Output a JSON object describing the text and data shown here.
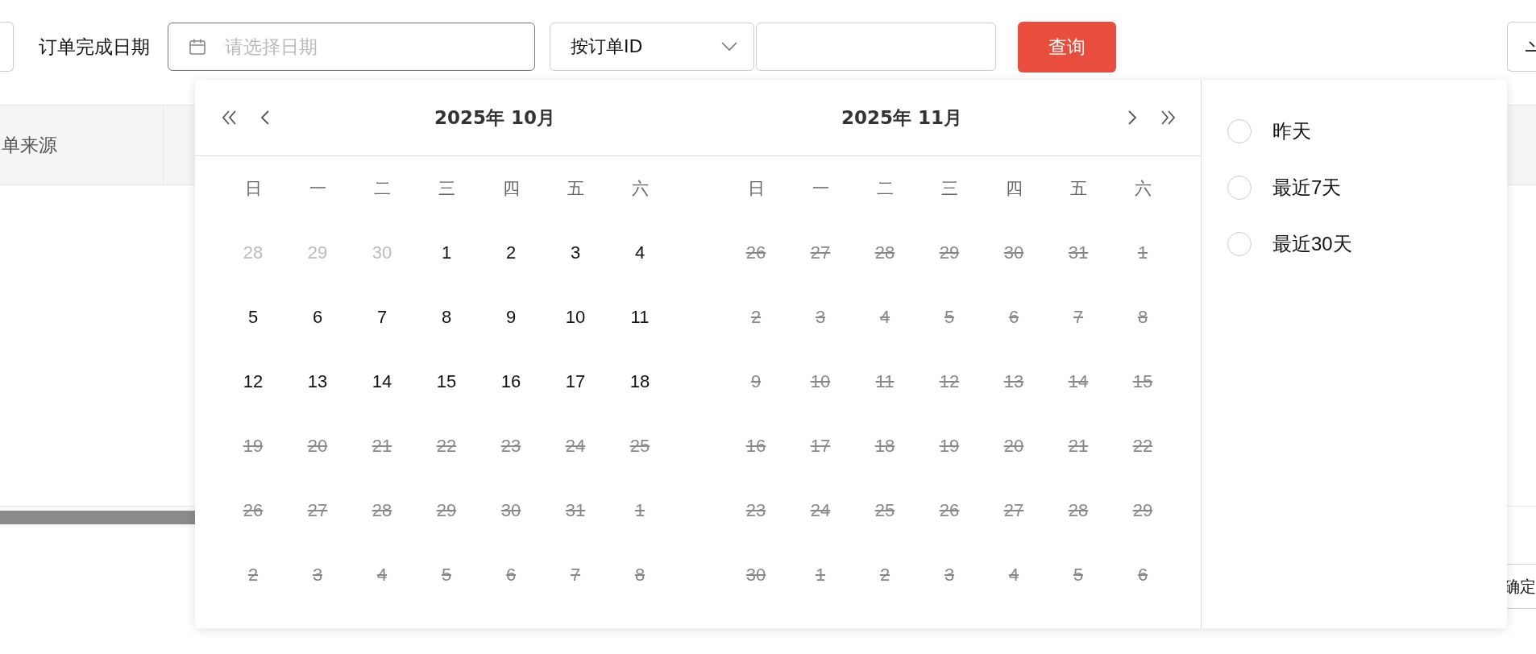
{
  "filter": {
    "label": "订单完成日期",
    "date_field": {
      "placeholder": "请选择日期"
    },
    "id_select": {
      "value": "按订单ID"
    },
    "query_button": "查询"
  },
  "table": {
    "columns": [
      "单来源"
    ]
  },
  "pager": {
    "confirm_button": "确定"
  },
  "date_picker": {
    "months": [
      {
        "title": "2025年 10月",
        "weekdays": [
          "日",
          "一",
          "二",
          "三",
          "四",
          "五",
          "六"
        ],
        "weeks": [
          [
            {
              "label": "28",
              "kind": "other"
            },
            {
              "label": "29",
              "kind": "other"
            },
            {
              "label": "30",
              "kind": "other"
            },
            {
              "label": "1",
              "kind": "current"
            },
            {
              "label": "2",
              "kind": "current"
            },
            {
              "label": "3",
              "kind": "current"
            },
            {
              "label": "4",
              "kind": "current"
            }
          ],
          [
            {
              "label": "5",
              "kind": "current"
            },
            {
              "label": "6",
              "kind": "current"
            },
            {
              "label": "7",
              "kind": "current"
            },
            {
              "label": "8",
              "kind": "current"
            },
            {
              "label": "9",
              "kind": "current"
            },
            {
              "label": "10",
              "kind": "current"
            },
            {
              "label": "11",
              "kind": "current"
            }
          ],
          [
            {
              "label": "12",
              "kind": "current"
            },
            {
              "label": "13",
              "kind": "current"
            },
            {
              "label": "14",
              "kind": "current"
            },
            {
              "label": "15",
              "kind": "current"
            },
            {
              "label": "16",
              "kind": "current"
            },
            {
              "label": "17",
              "kind": "current"
            },
            {
              "label": "18",
              "kind": "current"
            }
          ],
          [
            {
              "label": "19",
              "kind": "disabled"
            },
            {
              "label": "20",
              "kind": "disabled"
            },
            {
              "label": "21",
              "kind": "disabled"
            },
            {
              "label": "22",
              "kind": "disabled"
            },
            {
              "label": "23",
              "kind": "disabled"
            },
            {
              "label": "24",
              "kind": "disabled"
            },
            {
              "label": "25",
              "kind": "disabled"
            }
          ],
          [
            {
              "label": "26",
              "kind": "disabled"
            },
            {
              "label": "27",
              "kind": "disabled"
            },
            {
              "label": "28",
              "kind": "disabled"
            },
            {
              "label": "29",
              "kind": "disabled"
            },
            {
              "label": "30",
              "kind": "disabled"
            },
            {
              "label": "31",
              "kind": "disabled"
            },
            {
              "label": "1",
              "kind": "disabled"
            }
          ],
          [
            {
              "label": "2",
              "kind": "disabled"
            },
            {
              "label": "3",
              "kind": "disabled"
            },
            {
              "label": "4",
              "kind": "disabled"
            },
            {
              "label": "5",
              "kind": "disabled"
            },
            {
              "label": "6",
              "kind": "disabled"
            },
            {
              "label": "7",
              "kind": "disabled"
            },
            {
              "label": "8",
              "kind": "disabled"
            }
          ]
        ]
      },
      {
        "title": "2025年 11月",
        "weekdays": [
          "日",
          "一",
          "二",
          "三",
          "四",
          "五",
          "六"
        ],
        "weeks": [
          [
            {
              "label": "26",
              "kind": "disabled"
            },
            {
              "label": "27",
              "kind": "disabled"
            },
            {
              "label": "28",
              "kind": "disabled"
            },
            {
              "label": "29",
              "kind": "disabled"
            },
            {
              "label": "30",
              "kind": "disabled"
            },
            {
              "label": "31",
              "kind": "disabled"
            },
            {
              "label": "1",
              "kind": "disabled"
            }
          ],
          [
            {
              "label": "2",
              "kind": "disabled"
            },
            {
              "label": "3",
              "kind": "disabled"
            },
            {
              "label": "4",
              "kind": "disabled"
            },
            {
              "label": "5",
              "kind": "disabled"
            },
            {
              "label": "6",
              "kind": "disabled"
            },
            {
              "label": "7",
              "kind": "disabled"
            },
            {
              "label": "8",
              "kind": "disabled"
            }
          ],
          [
            {
              "label": "9",
              "kind": "disabled"
            },
            {
              "label": "10",
              "kind": "disabled"
            },
            {
              "label": "11",
              "kind": "disabled"
            },
            {
              "label": "12",
              "kind": "disabled"
            },
            {
              "label": "13",
              "kind": "disabled"
            },
            {
              "label": "14",
              "kind": "disabled"
            },
            {
              "label": "15",
              "kind": "disabled"
            }
          ],
          [
            {
              "label": "16",
              "kind": "disabled"
            },
            {
              "label": "17",
              "kind": "disabled"
            },
            {
              "label": "18",
              "kind": "disabled"
            },
            {
              "label": "19",
              "kind": "disabled"
            },
            {
              "label": "20",
              "kind": "disabled"
            },
            {
              "label": "21",
              "kind": "disabled"
            },
            {
              "label": "22",
              "kind": "disabled"
            }
          ],
          [
            {
              "label": "23",
              "kind": "disabled"
            },
            {
              "label": "24",
              "kind": "disabled"
            },
            {
              "label": "25",
              "kind": "disabled"
            },
            {
              "label": "26",
              "kind": "disabled"
            },
            {
              "label": "27",
              "kind": "disabled"
            },
            {
              "label": "28",
              "kind": "disabled"
            },
            {
              "label": "29",
              "kind": "disabled"
            }
          ],
          [
            {
              "label": "30",
              "kind": "disabled"
            },
            {
              "label": "1",
              "kind": "disabled"
            },
            {
              "label": "2",
              "kind": "disabled"
            },
            {
              "label": "3",
              "kind": "disabled"
            },
            {
              "label": "4",
              "kind": "disabled"
            },
            {
              "label": "5",
              "kind": "disabled"
            },
            {
              "label": "6",
              "kind": "disabled"
            }
          ]
        ]
      }
    ],
    "shortcuts": [
      {
        "label": "昨天",
        "selected": false
      },
      {
        "label": "最近7天",
        "selected": false
      },
      {
        "label": "最近30天",
        "selected": false
      }
    ]
  }
}
